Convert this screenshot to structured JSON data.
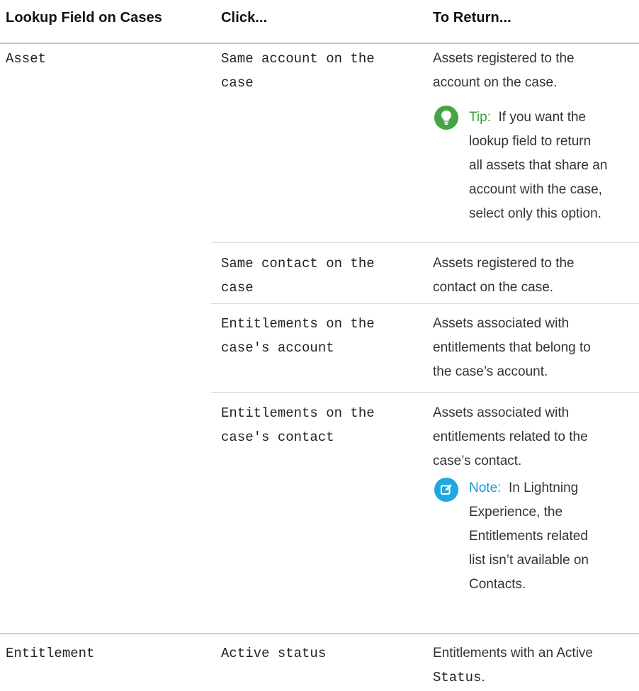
{
  "columns": {
    "lookup_field": "Lookup Field on Cases",
    "click": "Click...",
    "to_return": "To Return..."
  },
  "rows": {
    "asset": {
      "field": "Asset",
      "same_account": {
        "click_line1": "Same account on the",
        "click_line2": "case",
        "ret_line1": "Assets registered to the",
        "ret_line2": "account on the case."
      },
      "tip": {
        "label": "Tip:",
        "line1": "If you want the",
        "line2": "lookup field to return",
        "line3": "all assets that share an",
        "line4": "account with the case,",
        "line5": "select only this option."
      },
      "same_contact": {
        "click_line1": "Same contact on the",
        "click_line2": "case",
        "ret_line1": "Assets registered to the",
        "ret_line2": "contact on the case."
      },
      "ent_account": {
        "click_line1": "Entitlements on the",
        "click_line2": "case's account",
        "ret_line1": "Assets associated with",
        "ret_line2": "entitlements that belong to",
        "ret_line3": "the case’s account."
      },
      "ent_contact": {
        "click_line1": "Entitlements on the",
        "click_line2": "case's contact",
        "ret_line1": "Assets associated with",
        "ret_line2": "entitlements related to the",
        "ret_line3": "case’s contact."
      },
      "note": {
        "label": "Note:",
        "line1": "In Lightning",
        "line2": "Experience, the",
        "line3": "Entitlements related",
        "line4": "list isn’t available on",
        "line5": "Contacts."
      }
    },
    "entitlement": {
      "field": "Entitlement",
      "click": "Active status",
      "ret_line1": "Entitlements with an Active",
      "ret_code": "Status",
      "ret_end": "."
    }
  },
  "icons": {
    "tip": "lightbulb-icon",
    "note": "edit-note-icon"
  },
  "colors": {
    "tip_green": "#45a543",
    "note_blue": "#1ea7e0"
  }
}
